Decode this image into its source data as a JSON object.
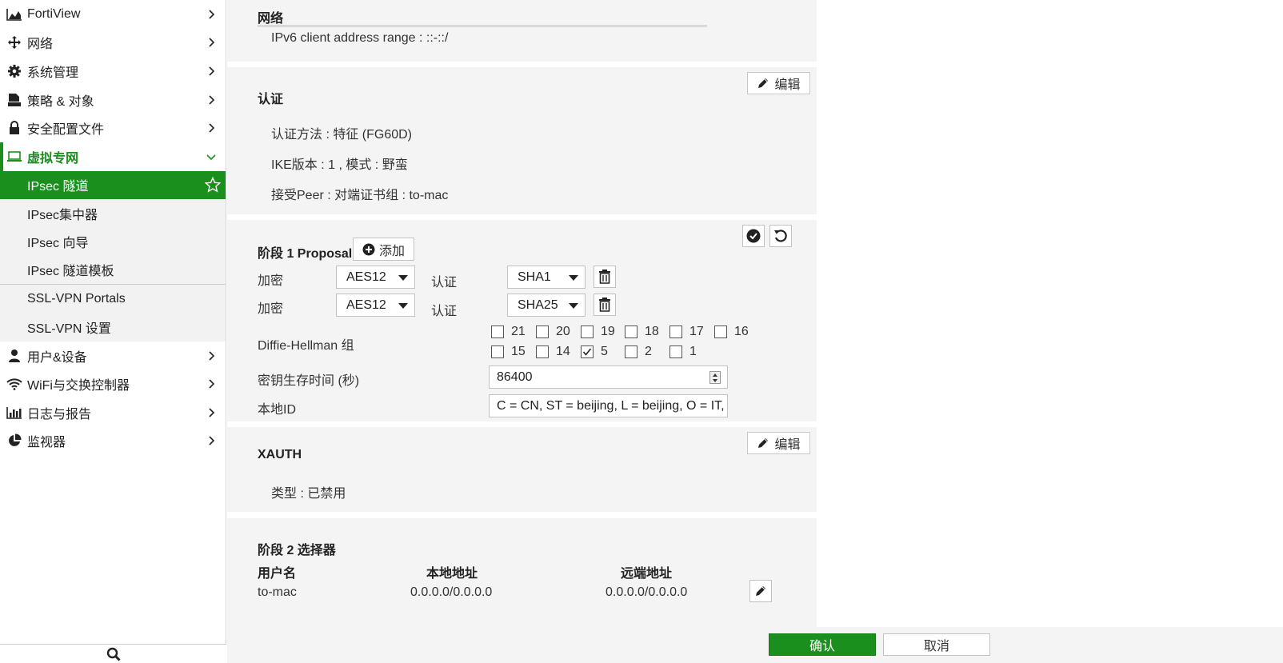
{
  "sidebar": {
    "items": [
      {
        "label": "FortiView",
        "icon": "area-chart-icon"
      },
      {
        "label": "网络",
        "icon": "arrows-move-icon"
      },
      {
        "label": "系统管理",
        "icon": "gear-icon"
      },
      {
        "label": "策略 & 对象",
        "icon": "policy-doc-icon"
      },
      {
        "label": "安全配置文件",
        "icon": "lock-icon"
      },
      {
        "label": "虚拟专网",
        "icon": "laptop-icon"
      },
      {
        "label": "用户&设备",
        "icon": "user-icon"
      },
      {
        "label": "WiFi与交换控制器",
        "icon": "wifi-icon"
      },
      {
        "label": "日志与报告",
        "icon": "bar-chart-icon"
      },
      {
        "label": "监视器",
        "icon": "pie-chart-icon"
      }
    ],
    "vpn_sub": [
      {
        "label": "IPsec 隧道"
      },
      {
        "label": "IPsec集中器"
      },
      {
        "label": "IPsec 向导"
      },
      {
        "label": "IPsec 隧道模板"
      },
      {
        "label": "SSL-VPN Portals"
      },
      {
        "label": "SSL-VPN 设置"
      }
    ]
  },
  "network": {
    "title": "网络",
    "ipv6_range": "IPv6 client address range : ::-::/"
  },
  "auth": {
    "title": "认证",
    "edit_label": "编辑",
    "method": "认证方法 : 特征 (FG60D)",
    "ike": "IKE版本 : 1 , 模式 : 野蛮",
    "peer": "接受Peer : 对端证书组 : to-mac"
  },
  "phase1": {
    "title": "阶段 1 Proposal",
    "add_label": "添加",
    "enc_label": "加密",
    "auth_label": "认证",
    "rows": [
      {
        "enc": "AES12",
        "auth": "SHA1"
      },
      {
        "enc": "AES12",
        "auth": "SHA25"
      }
    ],
    "dh_label": "Diffie-Hellman 组",
    "dh_groups_row1": [
      {
        "num": "21",
        "checked": false
      },
      {
        "num": "20",
        "checked": false
      },
      {
        "num": "19",
        "checked": false
      },
      {
        "num": "18",
        "checked": false
      },
      {
        "num": "17",
        "checked": false
      },
      {
        "num": "16",
        "checked": false
      }
    ],
    "dh_groups_row2": [
      {
        "num": "15",
        "checked": false
      },
      {
        "num": "14",
        "checked": false
      },
      {
        "num": "5",
        "checked": true
      },
      {
        "num": "2",
        "checked": false
      },
      {
        "num": "1",
        "checked": false
      }
    ],
    "keylife_label": "密钥生存时间 (秒)",
    "keylife_value": "86400",
    "localid_label": "本地ID",
    "localid_value": "C = CN, ST = beijing, L = beijing, O = IT, OU = IT"
  },
  "xauth": {
    "title": "XAUTH",
    "edit_label": "编辑",
    "type": "类型 : 已禁用"
  },
  "phase2": {
    "title": "阶段 2 选择器",
    "headers": [
      "用户名",
      "本地地址",
      "远端地址"
    ],
    "rows": [
      {
        "name": "to-mac",
        "local": "0.0.0.0/0.0.0.0",
        "remote": "0.0.0.0/0.0.0.0"
      }
    ]
  },
  "footer": {
    "ok_label": "确认",
    "cancel_label": "取消"
  },
  "colors": {
    "accent_green": "#1a8f1e",
    "card_bg": "#f4f4f4"
  }
}
